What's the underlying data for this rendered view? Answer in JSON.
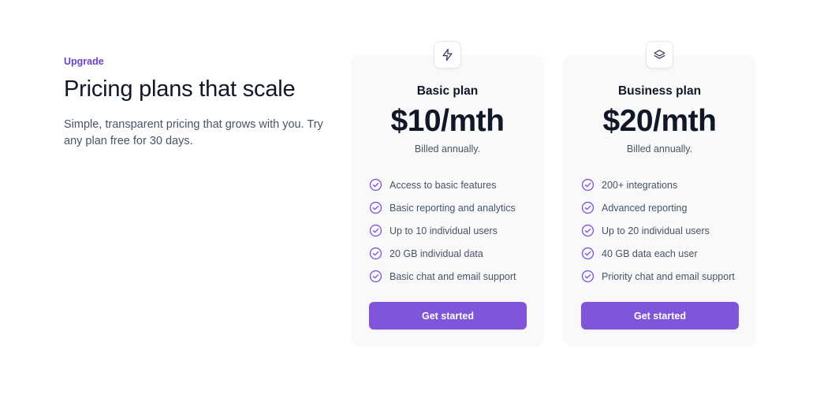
{
  "header": {
    "eyebrow": "Upgrade",
    "title": "Pricing plans that scale",
    "subtitle": "Simple, transparent pricing that grows with you. Try any plan free for 30 days."
  },
  "colors": {
    "accent": "#7f56d9",
    "accent_text": "#6941c6",
    "card_background": "#f9f9fa"
  },
  "plans": [
    {
      "icon": "lightning-bolt-icon",
      "name": "Basic plan",
      "price": "$10/mth",
      "billing": "Billed annually.",
      "features": [
        "Access to basic features",
        "Basic reporting and analytics",
        "Up to 10 individual users",
        "20 GB individual data",
        "Basic chat and email support"
      ],
      "cta": "Get started"
    },
    {
      "icon": "layers-icon",
      "name": "Business plan",
      "price": "$20/mth",
      "billing": "Billed annually.",
      "features": [
        "200+ integrations",
        "Advanced reporting",
        "Up to 20 individual users",
        "40 GB data each user",
        "Priority chat and email support"
      ],
      "cta": "Get started"
    }
  ]
}
